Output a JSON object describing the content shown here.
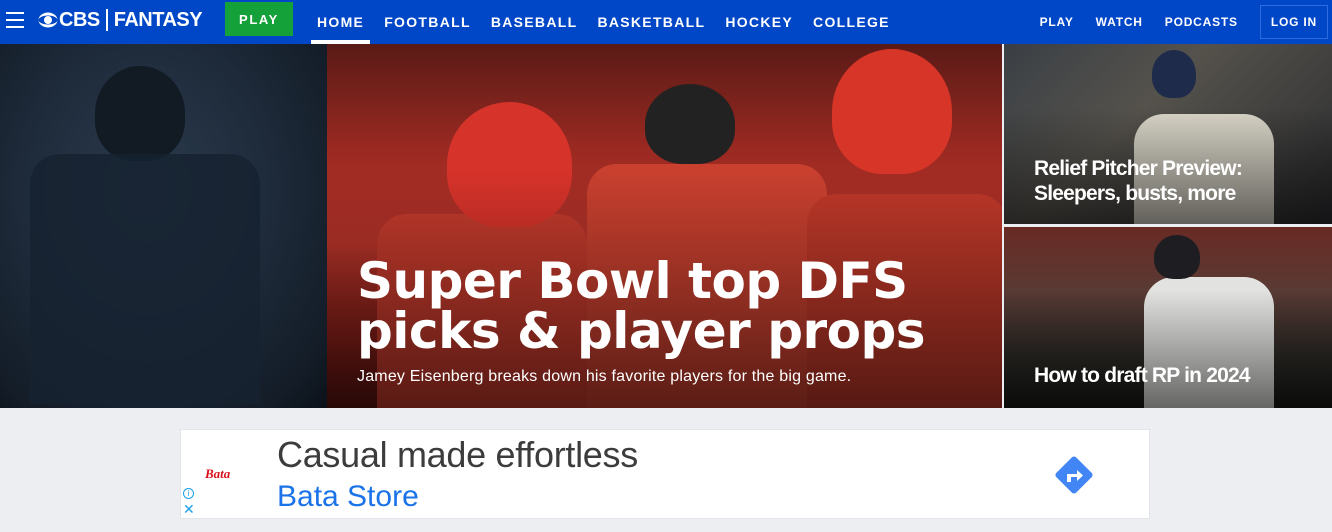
{
  "header": {
    "brand_left": "CBS",
    "brand_right": "FANTASY",
    "play_button": "PLAY",
    "nav": [
      {
        "label": "HOME",
        "active": true
      },
      {
        "label": "FOOTBALL",
        "active": false
      },
      {
        "label": "BASEBALL",
        "active": false
      },
      {
        "label": "BASKETBALL",
        "active": false
      },
      {
        "label": "HOCKEY",
        "active": false
      },
      {
        "label": "COLLEGE",
        "active": false
      }
    ],
    "right_nav": [
      "PLAY",
      "WATCH",
      "PODCASTS"
    ],
    "login": "LOG IN"
  },
  "hero": {
    "title_line1": "Super Bowl top DFS",
    "title_line2": "picks & player props",
    "subtitle": "Jamey Eisenberg breaks down his favorite players for the big game."
  },
  "side_stories": [
    {
      "line1": "Relief Pitcher Preview:",
      "line2": "Sleepers, busts, more"
    },
    {
      "line1": "How to draft RP in 2024",
      "line2": ""
    }
  ],
  "ad": {
    "brand": "Bata",
    "headline": "Casual made effortless",
    "store": "Bata Store",
    "info_icon": "i",
    "close_icon": "✕"
  },
  "colors": {
    "header_bg": "#0047c8",
    "play_green": "#15a13a",
    "ad_blue": "#1a73e8",
    "ad_brand_red": "#d8101a"
  }
}
